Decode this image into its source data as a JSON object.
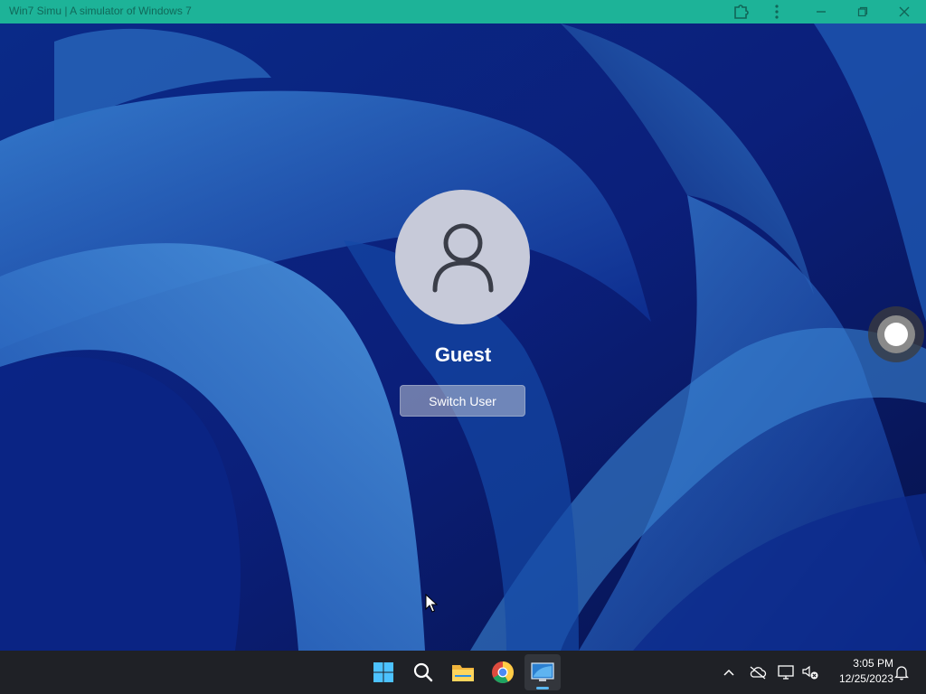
{
  "window": {
    "title": "Win7 Simu | A simulator of Windows 7",
    "titlebar_color": "#1db398",
    "controls": [
      "extension-icon",
      "more-icon",
      "minimize-icon",
      "restore-icon",
      "close-icon"
    ]
  },
  "login": {
    "username": "Guest",
    "switch_user_label": "Switch User",
    "avatar_icon": "user-icon"
  },
  "taskbar": {
    "apps": [
      "windows-start-icon",
      "search-icon",
      "file-explorer-icon",
      "chrome-icon",
      "win7simu-app-icon"
    ],
    "active_app": "win7simu-app-icon",
    "tray": [
      "chevron-up-icon",
      "cloud-off-icon",
      "display-icon",
      "volume-muted-icon",
      "bell-icon"
    ],
    "time": "3:05 PM",
    "date": "12/25/2023"
  },
  "colors": {
    "wallpaper_dark": "#07165a",
    "wallpaper_light": "#2a72c8",
    "taskbar": "#1f2126",
    "accent": "#59b6f0"
  }
}
